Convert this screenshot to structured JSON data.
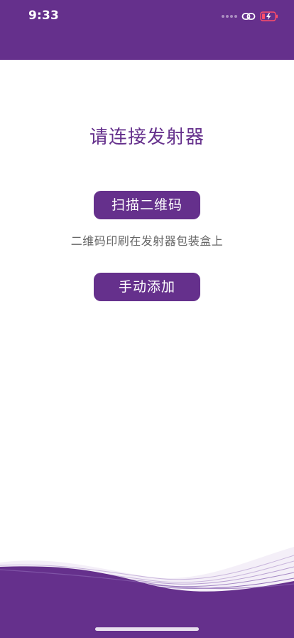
{
  "status_bar": {
    "time": "9:33"
  },
  "colors": {
    "brand": "#65308c",
    "hint_text": "#666666",
    "background": "#ffffff"
  },
  "main": {
    "title": "请连接发射器",
    "scan_button_label": "扫描二维码",
    "hint": "二维码印刷在发射器包装盒上",
    "manual_button_label": "手动添加"
  },
  "icons": [
    "cellular-signal-icon",
    "link-icon",
    "battery-charging-icon"
  ]
}
